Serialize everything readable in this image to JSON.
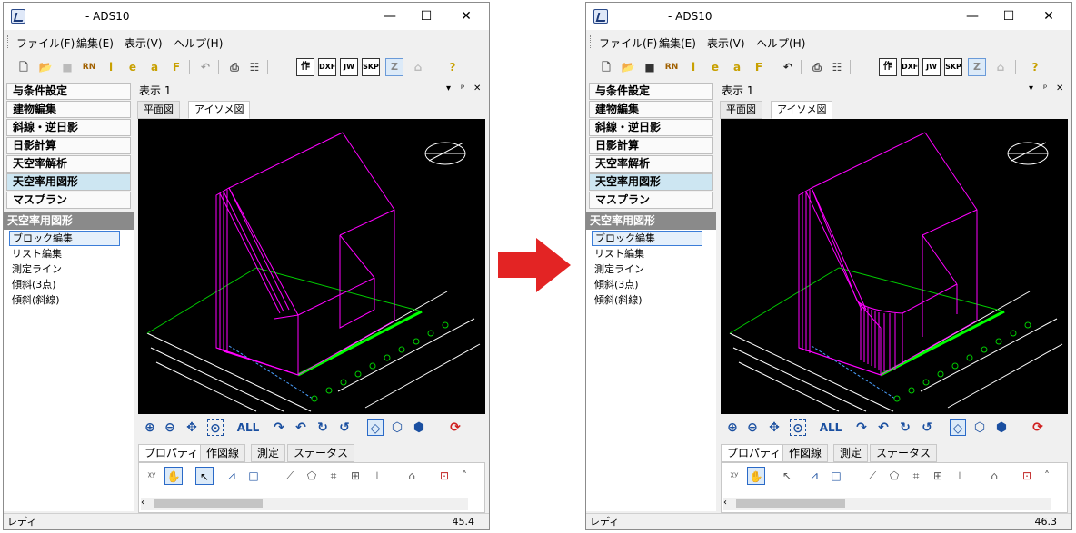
{
  "arrow_color": "#e32424",
  "left": {
    "title": "- ADS10",
    "status_text": "レディ",
    "status_value": "45.4"
  },
  "right": {
    "title": "- ADS10",
    "status_text": "レディ",
    "status_value": "46.3"
  },
  "window_controls": [
    "—",
    "☐",
    "✕"
  ],
  "menu": [
    "ファイル(F)",
    "編集(E)",
    "表示(V)",
    "ヘルプ(H)"
  ],
  "toolbar": {
    "info_label": "i",
    "e_label": "e",
    "a_label": "a",
    "f_label": "F",
    "saku_label": "作",
    "dxf_label": "DXF",
    "jw_label": "JW",
    "skp_label": "SKP",
    "z_label": "Z",
    "help_label": "?"
  },
  "categories": [
    "与条件設定",
    "建物編集",
    "斜線・逆日影",
    "日影計算",
    "天空率解析",
    "天空率用図形",
    "マスプラン"
  ],
  "active_category": "天空率用図形",
  "sub_header": "天空率用図形",
  "sub_items": [
    "ブロック編集",
    "リスト編集",
    "測定ライン",
    "傾斜(3点)",
    "傾斜(斜線)"
  ],
  "selected_sub_item": "ブロック編集",
  "pane_title": "表示 1",
  "pane_controls": [
    "▾",
    "ᵖ",
    "✕"
  ],
  "view_tabs": [
    "平面図",
    "アイソメ図"
  ],
  "active_view_tab": "アイソメ図",
  "viewbar": {
    "all_label": "ALL"
  },
  "bottom_tabs": [
    "プロパティ",
    "作図線",
    "測定",
    "ステータス"
  ],
  "active_bottom_tab": "プロパティ",
  "colors": {
    "building": "#ff00ff",
    "ground_line": "#00ff00",
    "road_lines": "#ffffff",
    "measure_points": "#00cc00"
  }
}
